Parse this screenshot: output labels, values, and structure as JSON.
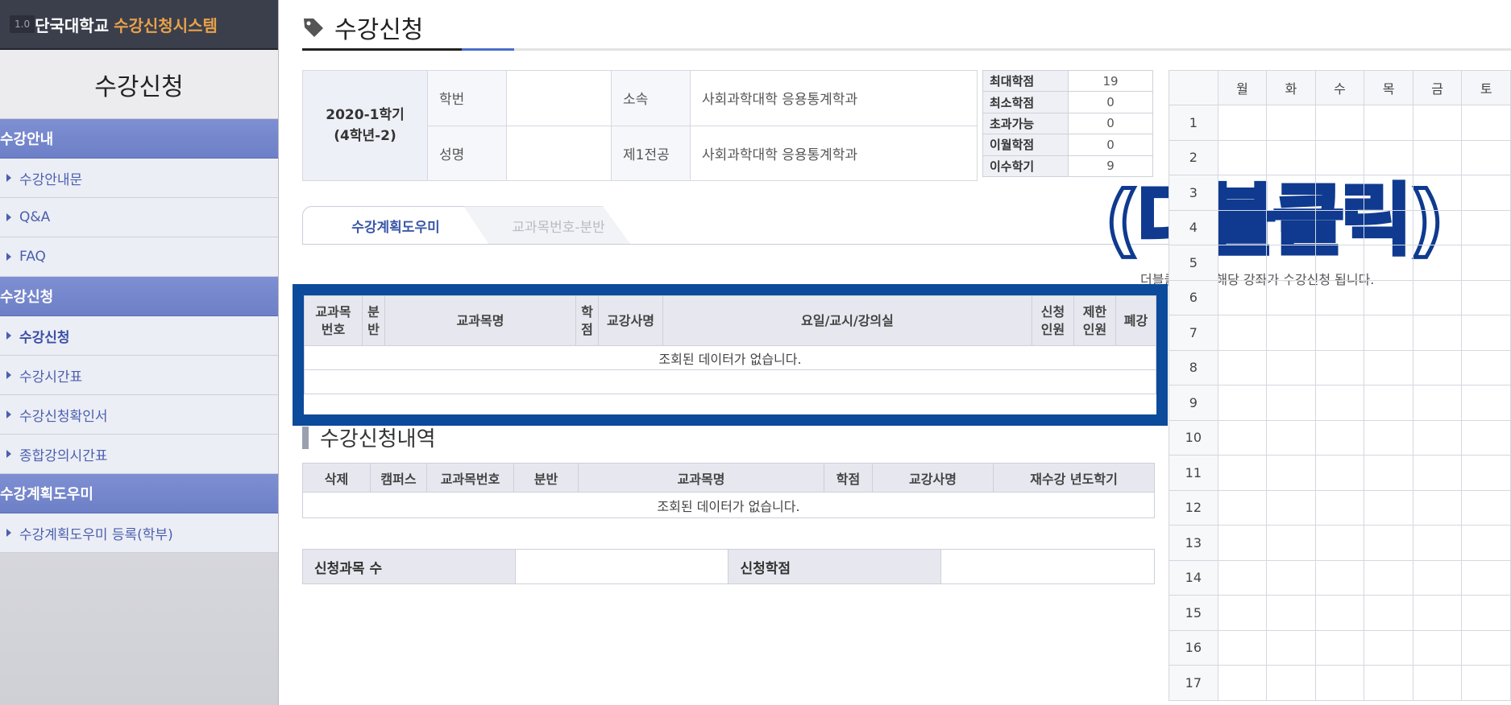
{
  "brand": {
    "version": "1.0",
    "university": "단국대학교",
    "system": "수강신청시스템"
  },
  "sidebar": {
    "title": "수강신청",
    "sections": [
      {
        "label": "수강안내",
        "items": [
          "수강안내문",
          "Q&A",
          "FAQ"
        ]
      },
      {
        "label": "수강신청",
        "items": [
          "수강신청",
          "수강시간표",
          "수강신청확인서",
          "종합강의시간표"
        ]
      },
      {
        "label": "수강계획도우미",
        "items": [
          "수강계획도우미 등록(학부)"
        ]
      }
    ]
  },
  "page": {
    "title": "수강신청"
  },
  "info": {
    "semester": "2020-1학기",
    "year_level": "(4학년-2)",
    "student_id_label": "학번",
    "student_id": "",
    "dept_label": "소속",
    "dept": "사회과학대학 응용통계학과",
    "name_label": "성명",
    "name": "",
    "major_label": "제1전공",
    "major": "사회과학대학 응용통계학과"
  },
  "credits": [
    {
      "label": "최대학점",
      "value": "19"
    },
    {
      "label": "최소학점",
      "value": "0"
    },
    {
      "label": "초과가능",
      "value": "0"
    },
    {
      "label": "이월학점",
      "value": "0"
    },
    {
      "label": "이수학기",
      "value": "9"
    }
  ],
  "tabs": {
    "tab1": "수강계획도우미",
    "tab2": "교과목번호-분반"
  },
  "overlay_caption": "(더블클릭)",
  "double_click_note": "더블클릭하면 해당 강좌가 수강신청 됩니다.",
  "course_table": {
    "headers": [
      "교과목\n번호",
      "분\n반",
      "교과목명",
      "학\n점",
      "교강사명",
      "요일/교시/강의실",
      "신청\n인원",
      "제한\n인원",
      "폐강"
    ],
    "empty_message": "조회된 데이터가 없습니다."
  },
  "registered": {
    "title": "수강신청내역",
    "headers": [
      "삭제",
      "캠퍼스",
      "교과목번호",
      "분반",
      "교과목명",
      "학점",
      "교강사명",
      "재수강 년도학기"
    ],
    "empty_message": "조회된 데이터가 없습니다."
  },
  "summary": {
    "count_label": "신청과목 수",
    "count_value": "",
    "credit_label": "신청학점",
    "credit_value": ""
  },
  "timetable": {
    "days": [
      "월",
      "화",
      "수",
      "목",
      "금",
      "토"
    ],
    "periods": [
      "1",
      "2",
      "3",
      "4",
      "5",
      "6",
      "7",
      "8",
      "9",
      "10",
      "11",
      "12",
      "13",
      "14",
      "15",
      "16",
      "17"
    ]
  }
}
